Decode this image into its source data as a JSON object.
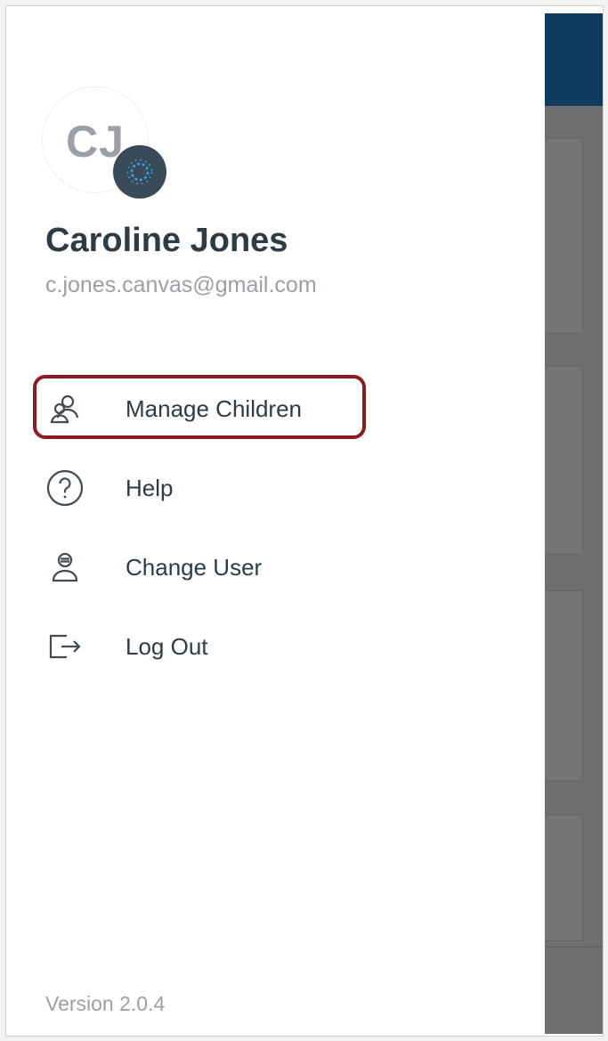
{
  "profile": {
    "initials": "CJ",
    "name": "Caroline Jones",
    "email": "c.jones.canvas@gmail.com",
    "badge_icon": "canvas-logo-icon"
  },
  "menu": {
    "items": [
      {
        "label": "Manage Children",
        "icon": "manage-children-icon",
        "highlighted": true
      },
      {
        "label": "Help",
        "icon": "help-icon"
      },
      {
        "label": "Change User",
        "icon": "change-user-icon"
      },
      {
        "label": "Log Out",
        "icon": "logout-icon"
      }
    ]
  },
  "footer": {
    "version": "Version 2.0.4"
  },
  "colors": {
    "accent_highlight": "#8b1b1f",
    "text_primary": "#2d3b45",
    "text_secondary": "#9aa0a6",
    "appbar": "#0f3b5f"
  }
}
